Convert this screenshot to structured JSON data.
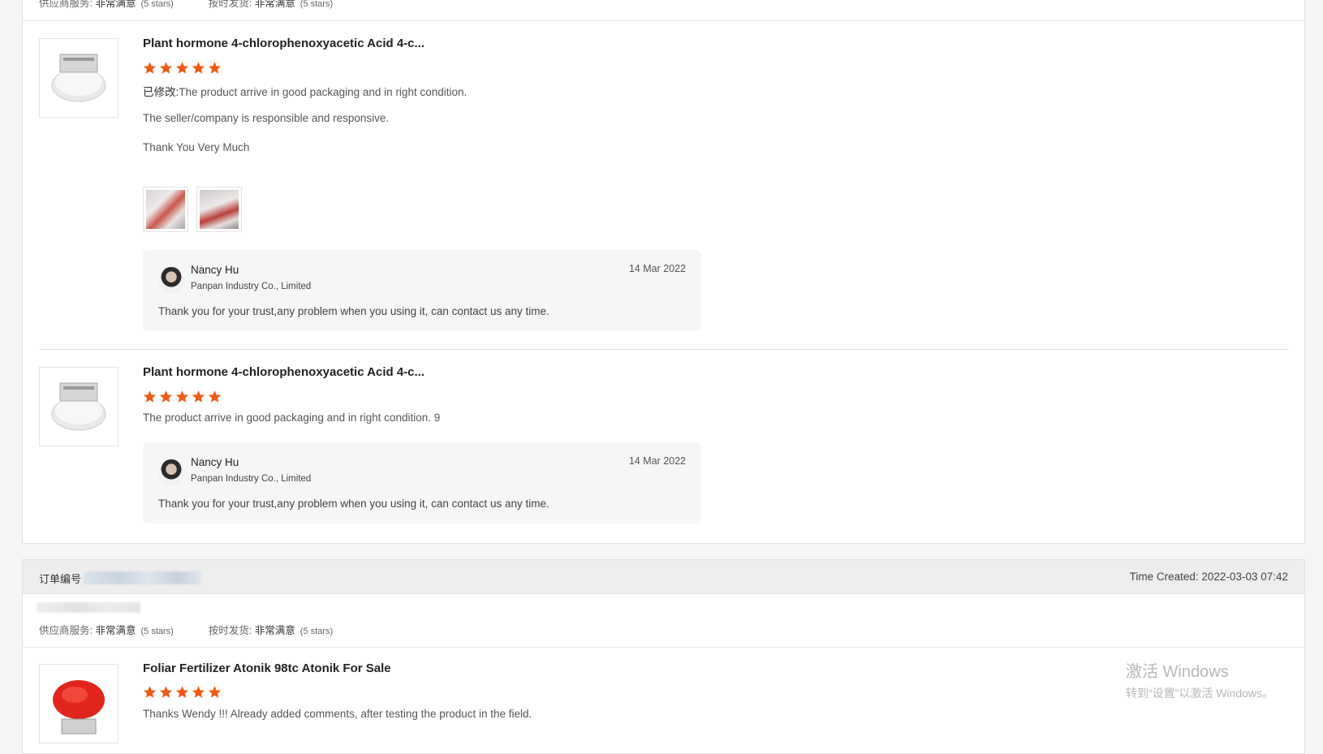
{
  "previous_order": {
    "service_label": "供应商服务:",
    "service_value": "非常满意",
    "service_stars": "(5 stars)",
    "delivery_label": "按时发货:",
    "delivery_value": "非常满意",
    "delivery_stars": "(5 stars)"
  },
  "reviews": [
    {
      "title": "Plant hormone 4-chlorophenoxyacetic Acid 4-c...",
      "rating": 5,
      "modified_prefix": "已修改:",
      "lines": [
        "The product arrive in good packaging and in right condition.",
        "The seller/company is responsible and responsive.",
        "Thank You Very Much"
      ],
      "reply": {
        "name": "Nancy Hu",
        "company": "Panpan Industry Co., Limited",
        "date": "14 Mar 2022",
        "message": "Thank you for your trust,any problem when you using it, can contact us any time."
      }
    },
    {
      "title": "Plant hormone 4-chlorophenoxyacetic Acid 4-c...",
      "rating": 5,
      "lines": [
        "The product arrive in good packaging and in right condition. 9"
      ],
      "reply": {
        "name": "Nancy Hu",
        "company": "Panpan Industry Co., Limited",
        "date": "14 Mar 2022",
        "message": "Thank you for your trust,any problem when you using it, can contact us any time."
      }
    }
  ],
  "next_order": {
    "order_label": "订单编号",
    "time_created": "Time Created: 2022-03-03 07:42",
    "service_label": "供应商服务:",
    "service_value": "非常满意",
    "service_stars": "(5 stars)",
    "delivery_label": "按时发货:",
    "delivery_value": "非常满意",
    "delivery_stars": "(5 stars)",
    "review": {
      "title": "Foliar Fertilizer Atonik 98tc Atonik For Sale",
      "rating": 5,
      "text": "Thanks Wendy !!!  Already added comments, after testing the product in the field."
    }
  },
  "watermark": {
    "line1": "激活 Windows",
    "line2": "转到“设置”以激活 Windows。"
  },
  "colors": {
    "star": "#f05a14",
    "reply_bg": "#f4f6f8",
    "order_bar": "#ededed"
  }
}
